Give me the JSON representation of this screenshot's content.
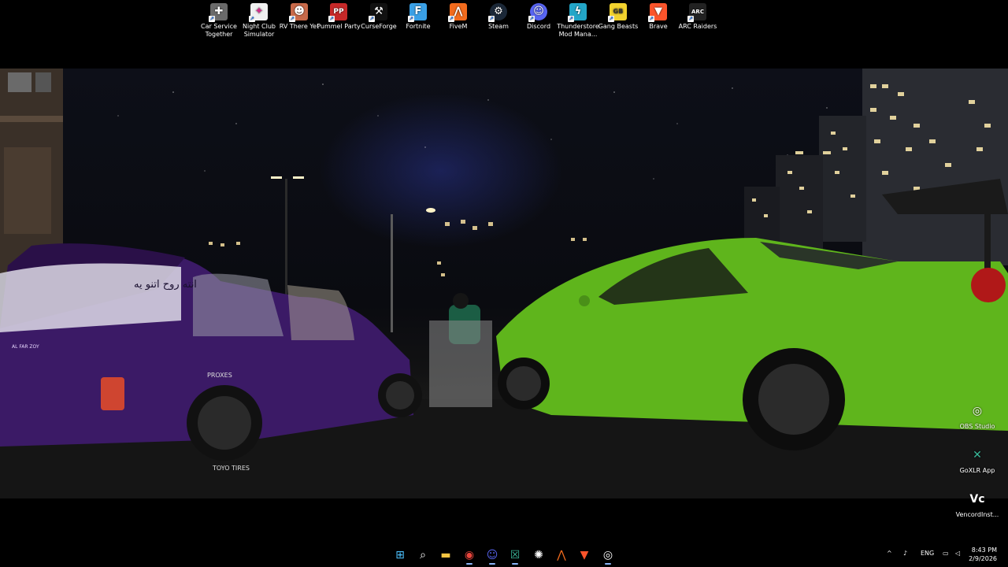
{
  "desktop": {
    "top_icons": [
      {
        "label": "Car Service Together",
        "icon": "car-service-icon",
        "color": "#6a6a6a"
      },
      {
        "label": "Night Club Simulator",
        "icon": "nightclub-icon",
        "color": "#e0e0e0"
      },
      {
        "label": "RV There Yet",
        "icon": "rv-icon",
        "color": "#c86a4a"
      },
      {
        "label": "Pummel Party",
        "icon": "pummel-party-icon",
        "color": "#c62828"
      },
      {
        "label": "CurseForge",
        "icon": "curseforge-icon",
        "color": "#111111"
      },
      {
        "label": "Fortnite",
        "icon": "fortnite-icon",
        "color": "#3aa0e6"
      },
      {
        "label": "FiveM",
        "icon": "fivem-icon",
        "color": "#f26b1d"
      },
      {
        "label": "Steam",
        "icon": "steam-icon",
        "color": "#1b2838"
      },
      {
        "label": "Discord",
        "icon": "discord-icon",
        "color": "#5865f2"
      },
      {
        "label": "Thunderstore Mod Mana...",
        "icon": "thunderstore-icon",
        "color": "#23a6c8"
      },
      {
        "label": "Gang Beasts",
        "icon": "gang-beasts-icon",
        "color": "#f2d22e"
      },
      {
        "label": "Brave",
        "icon": "brave-icon",
        "color": "#fb542b"
      },
      {
        "label": "ARC Raiders",
        "icon": "arc-raiders-icon",
        "color": "#222222"
      }
    ],
    "right_icons": [
      {
        "label": "OBS Studio",
        "icon": "obs-icon"
      },
      {
        "label": "GoXLR App",
        "icon": "goxlr-icon"
      },
      {
        "label": "VencordInst...",
        "icon": "vencord-icon"
      }
    ],
    "wallpaper": {
      "arabic_text": "انته روح اتنو يه",
      "plate_text": "AL FAR ZOY",
      "tire_text": "TOYO TIRES",
      "tire_text2": "PROXES"
    }
  },
  "taskbar": {
    "apps": [
      {
        "icon": "windows-start-icon"
      },
      {
        "icon": "search-icon"
      },
      {
        "icon": "file-explorer-icon"
      },
      {
        "icon": "chrome-icon"
      },
      {
        "icon": "discord-icon"
      },
      {
        "icon": "goxlr-icon"
      },
      {
        "icon": "elgato-icon"
      },
      {
        "icon": "fivem-icon"
      },
      {
        "icon": "brave-icon"
      },
      {
        "icon": "obs-icon"
      }
    ],
    "tray": {
      "chevron": "^",
      "lang": "ENG",
      "time": "8:43 PM",
      "date": "2/9/2026"
    }
  }
}
